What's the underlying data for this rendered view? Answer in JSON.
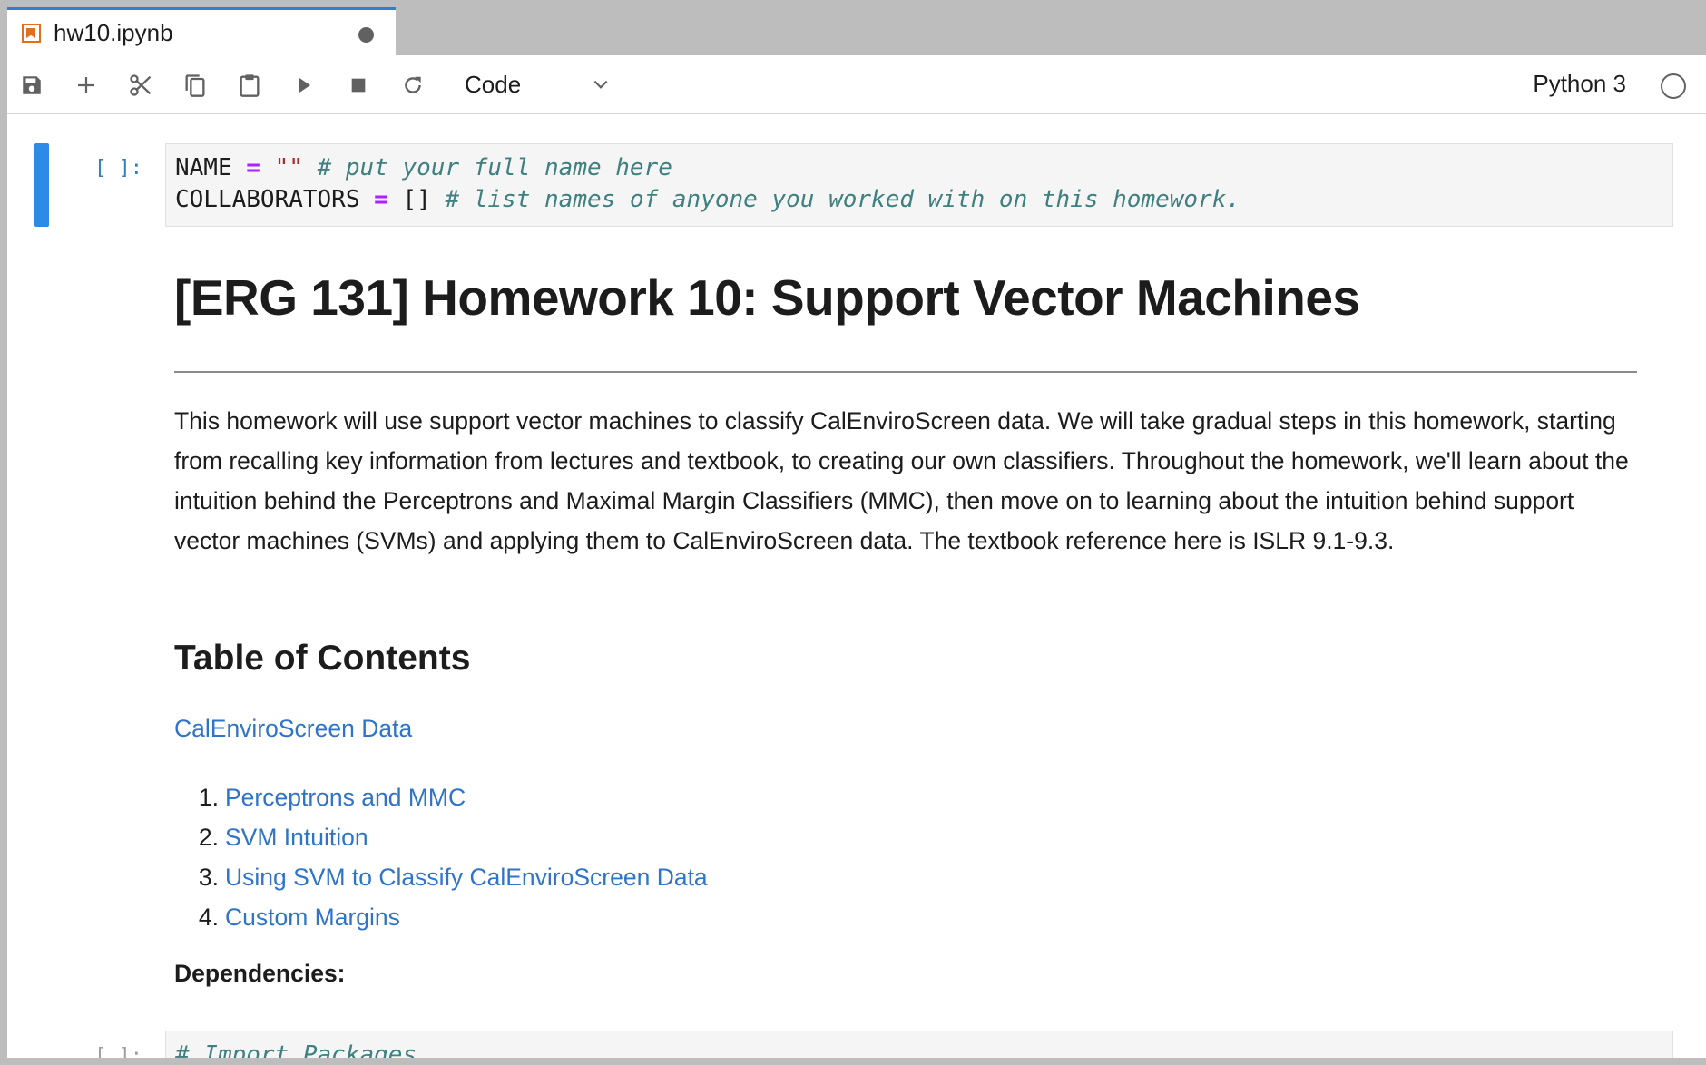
{
  "tab": {
    "title": "hw10.ipynb",
    "icon": "notebook-icon",
    "status": "unsaved-dot"
  },
  "toolbar": {
    "buttons": [
      "save-icon",
      "add-icon",
      "cut-icon",
      "copy-icon",
      "paste-icon",
      "run-icon",
      "stop-icon",
      "restart-icon"
    ],
    "cell_type": "Code",
    "kernel_name": "Python 3",
    "kernel_status": "idle"
  },
  "cells": {
    "cell1": {
      "prompt": "[ ]:",
      "line1": {
        "var": "NAME",
        "op": "=",
        "value": "\"\"",
        "comment": "# put your full name here"
      },
      "line2": {
        "var": "COLLABORATORS",
        "op": "=",
        "value": "[]",
        "comment": "# list names of anyone you worked with on this homework."
      }
    },
    "markdown": {
      "title": "[ERG 131] Homework 10: Support Vector Machines",
      "paragraph": "This homework will use support vector machines to classify CalEnviroScreen data. We will take gradual steps in this homework, starting from recalling key information from lectures and textbook, to creating our own classifiers. Throughout the homework, we'll learn about the intuition behind the Perceptrons and Maximal Margin Classifiers (MMC), then move on to learning about the intuition behind support vector machines (SVMs) and applying them to CalEnviroScreen data. The textbook reference here is ISLR 9.1-9.3.",
      "toc_heading": "Table of Contents",
      "toc_first": "CalEnviroScreen Data",
      "toc_items": [
        {
          "num": "1.",
          "label": "Perceptrons and MMC"
        },
        {
          "num": "2.",
          "label": "SVM Intuition"
        },
        {
          "num": "3.",
          "label": "Using SVM to Classify CalEnviroScreen Data"
        },
        {
          "num": "4.",
          "label": "Custom Margins"
        }
      ],
      "dependencies": "Dependencies:"
    },
    "cell2": {
      "prompt": "[ ]:",
      "line1": "# Import Packages"
    }
  },
  "colors": {
    "active_cell": "#2d8ae6",
    "link": "#2f74c7",
    "tab_accent": "#2f7fd6",
    "notebook_icon": "#e46e1f"
  }
}
